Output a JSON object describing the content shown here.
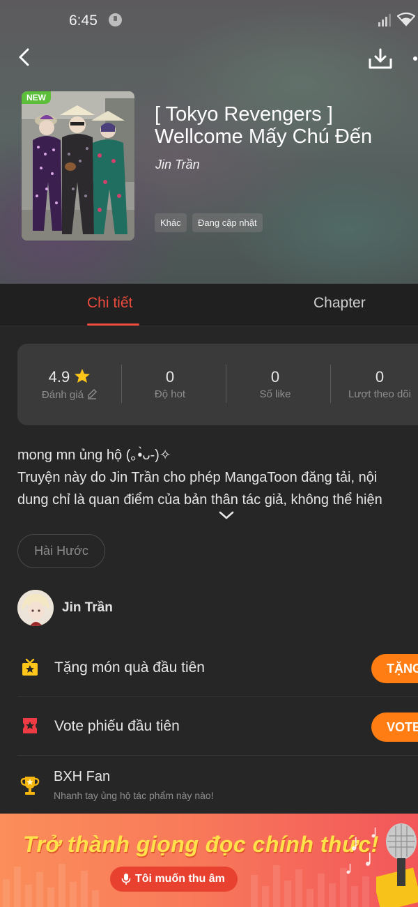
{
  "status_bar": {
    "time": "6:45"
  },
  "header": {
    "title": "[ Tokyo Revengers ] Wellcome Mấy Chú Đến",
    "author": "Jin Trần",
    "badge": "NEW",
    "tags": [
      "Khác",
      "Đang cập nhật"
    ]
  },
  "tabs": [
    {
      "label": "Chi tiết",
      "active": true
    },
    {
      "label": "Chapter",
      "active": false
    }
  ],
  "stats": [
    {
      "value": "4.9",
      "label": "Đánh giá"
    },
    {
      "value": "0",
      "label": "Độ hot"
    },
    {
      "value": "0",
      "label": "Số like"
    },
    {
      "value": "0",
      "label": "Lượt theo dõi"
    }
  ],
  "description": {
    "lines": [
      "mong mn ủng hộ (｡•̀ᴗ-)✧",
      "Truyện này do Jin Trần cho phép MangaToon đăng tải, nội",
      "dung chỉ là quan điểm của bản thân tác giả, không thể hiện"
    ]
  },
  "genre": "Hài Hước",
  "author_row": {
    "name": "Jin Trần"
  },
  "actions": [
    {
      "label": "Tặng món quà đầu tiên",
      "button": "TẶNG"
    },
    {
      "label": "Vote phiếu đầu tiên",
      "button": "VOTE"
    }
  ],
  "ranking": {
    "title": "BXH Fan",
    "subtitle": "Nhanh tay ủng hộ tác phẩm này nào!"
  },
  "banner": {
    "headline": "Trở thành giọng đọc chính thức!",
    "button": "Tôi muốn thu âm"
  },
  "colors": {
    "accent": "#ee4b3f",
    "action_orange": "#ff7d12",
    "star": "#ffc61a",
    "new_badge": "#5bbf3a"
  }
}
